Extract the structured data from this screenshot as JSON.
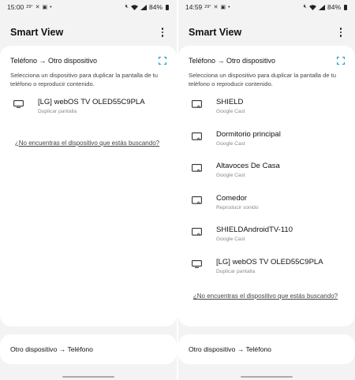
{
  "colors": {
    "background": "#f3f3f3",
    "card": "#ffffff",
    "accent": "#1aa3c8",
    "secondary_text": "#8a8a8a"
  },
  "screens": [
    {
      "status_bar": {
        "time": "15:00",
        "temperature": "29°",
        "battery": "84%"
      },
      "title": "Smart View",
      "section_title": "Teléfono → Otro dispositivo",
      "description": "Selecciona un dispositivo para duplicar la pantalla de tu teléfono o reproducir contenido.",
      "devices": [
        {
          "icon": "tv-icon",
          "name": "[LG] webOS TV OLED55C9PLA",
          "subtitle": "Duplicar pantalla"
        }
      ],
      "not_found_link": "¿No encuentras el dispositivo que estás buscando?",
      "bottom_section": "Otro dispositivo → Teléfono"
    },
    {
      "status_bar": {
        "time": "14:59",
        "temperature": "29°",
        "battery": "84%"
      },
      "title": "Smart View",
      "section_title": "Teléfono → Otro dispositivo",
      "description": "Selecciona un dispositivo para duplicar la pantalla de tu teléfono o reproducir contenido.",
      "devices": [
        {
          "icon": "cast-screen-icon",
          "name": "SHIELD",
          "subtitle": "Google Cast"
        },
        {
          "icon": "cast-screen-icon",
          "name": "Dormitorio principal",
          "subtitle": "Google Cast"
        },
        {
          "icon": "cast-screen-icon",
          "name": "Altavoces De Casa",
          "subtitle": "Google Cast"
        },
        {
          "icon": "cast-screen-icon",
          "name": "Comedor",
          "subtitle": "Reproducir sonido"
        },
        {
          "icon": "cast-screen-icon",
          "name": "SHIELDAndroidTV-110",
          "subtitle": "Google Cast"
        },
        {
          "icon": "tv-icon",
          "name": "[LG] webOS TV OLED55C9PLA",
          "subtitle": "Duplicar pantalla"
        }
      ],
      "not_found_link": "¿No encuentras el dispositivo que estás buscando?",
      "bottom_section": "Otro dispositivo → Teléfono"
    }
  ]
}
